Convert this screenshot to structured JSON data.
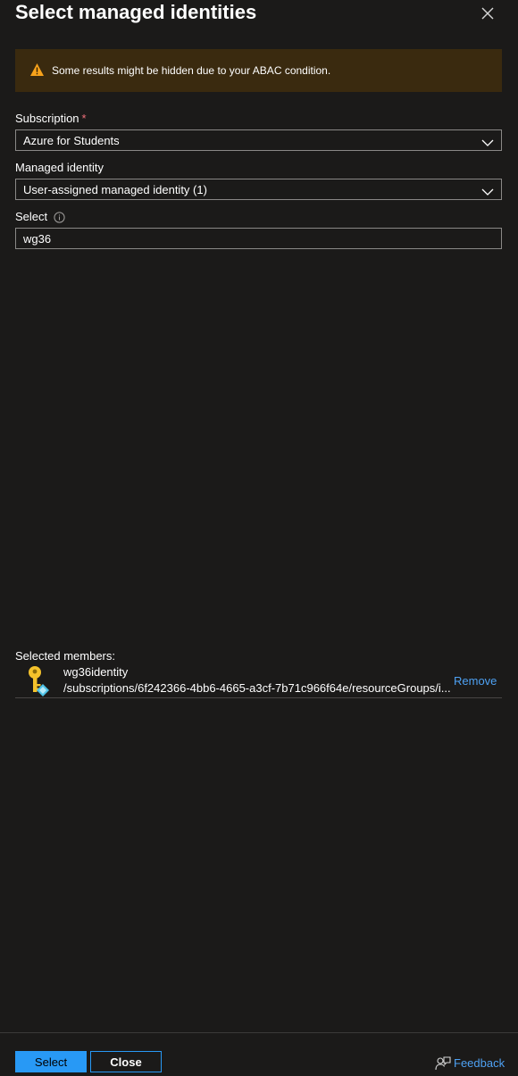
{
  "header": {
    "title": "Select managed identities",
    "close_icon": "close-icon"
  },
  "warning": {
    "icon": "warning-icon",
    "text": "Some results might be hidden due to your ABAC condition."
  },
  "subscription": {
    "label": "Subscription",
    "required_mark": "*",
    "value": "Azure for Students"
  },
  "managed_identity": {
    "label": "Managed identity",
    "value": "User-assigned managed identity (1)"
  },
  "select": {
    "label": "Select",
    "info_icon": "info-icon",
    "value": "wg36"
  },
  "selected_members": {
    "label": "Selected members:",
    "items": [
      {
        "name": "wg36identity",
        "path": "/subscriptions/6f242366-4bb6-4665-a3cf-7b71c966f64e/resourceGroups/i...",
        "remove_label": "Remove",
        "icon": "managed-identity-key-icon"
      }
    ]
  },
  "footer": {
    "select_button": "Select",
    "close_button": "Close",
    "feedback_label": "Feedback",
    "feedback_icon": "feedback-icon"
  },
  "colors": {
    "background": "#1b1a19",
    "accent": "#2899f5",
    "link": "#4ea1f3",
    "warning_bg": "#3a2a0f",
    "warning_icon": "#f7a21b",
    "required": "#f1707b"
  }
}
